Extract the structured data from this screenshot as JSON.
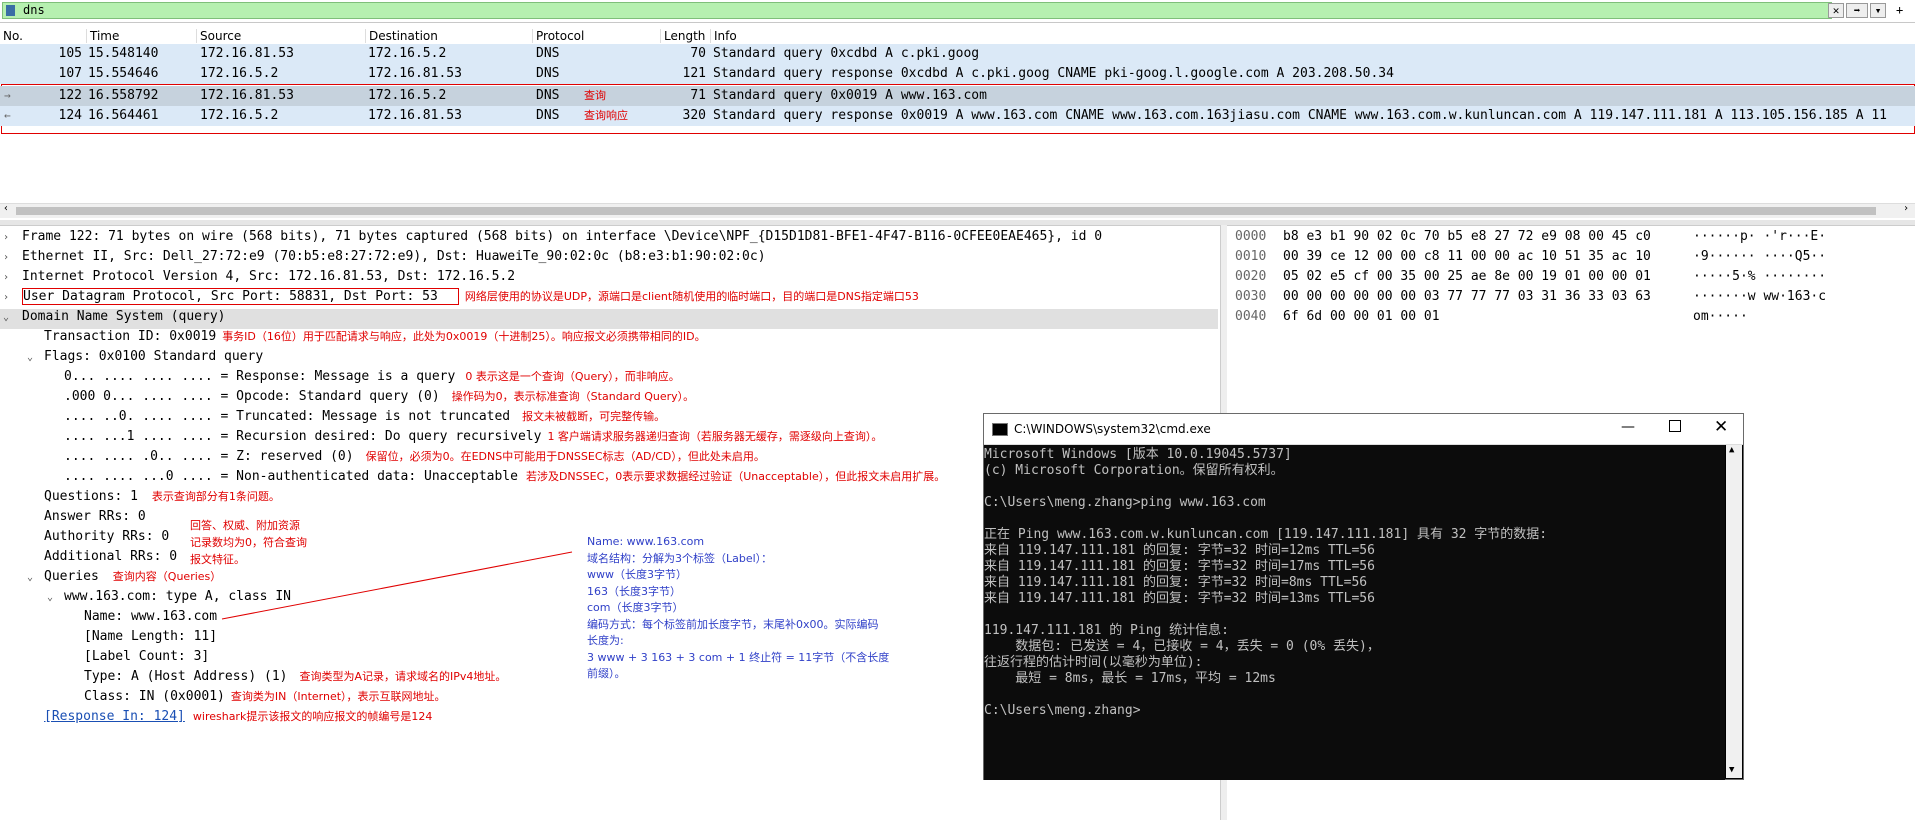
{
  "filter": {
    "value": "dns"
  },
  "packet_list": {
    "headers": [
      "No.",
      "Time",
      "Source",
      "Destination",
      "Protocol",
      "Length",
      "Info"
    ],
    "rows": [
      {
        "no": "105",
        "time": "15.548140",
        "src": "172.16.81.53",
        "dst": "172.16.5.2",
        "proto": "DNS",
        "len": "70",
        "info": "Standard query 0xcdbd A c.pki.goog",
        "note": ""
      },
      {
        "no": "107",
        "time": "15.554646",
        "src": "172.16.5.2",
        "dst": "172.16.81.53",
        "proto": "DNS",
        "len": "121",
        "info": "Standard query response 0xcdbd A c.pki.goog CNAME pki-goog.l.google.com A 203.208.50.34",
        "note": ""
      },
      {
        "no": "122",
        "time": "16.558792",
        "src": "172.16.81.53",
        "dst": "172.16.5.2",
        "proto": "DNS",
        "len": "71",
        "info": "Standard query 0x0019 A www.163.com",
        "note": "查询"
      },
      {
        "no": "124",
        "time": "16.564461",
        "src": "172.16.5.2",
        "dst": "172.16.81.53",
        "proto": "DNS",
        "len": "320",
        "info": "Standard query response 0x0019 A www.163.com CNAME www.163.com.163jiasu.com CNAME www.163.com.w.kunluncan.com A 119.147.111.181 A 113.105.156.185 A 11",
        "note": "查询响应"
      }
    ]
  },
  "details": {
    "frame": "Frame 122: 71 bytes on wire (568 bits), 71 bytes captured (568 bits) on interface \\Device\\NPF_{D15D1D81-BFE1-4F47-B116-0CFEE0EAE465}, id 0",
    "ethernet": "Ethernet II, Src: Dell_27:72:e9 (70:b5:e8:27:72:e9), Dst: HuaweiTe_90:02:0c (b8:e3:b1:90:02:0c)",
    "ip": "Internet Protocol Version 4, Src: 172.16.81.53, Dst: 172.16.5.2",
    "udp": "User Datagram Protocol, Src Port: 58831, Dst Port: 53",
    "udp_note": "网络层使用的协议是UDP，源端口是client随机使用的临时端口，目的端口是DNS指定端口53",
    "dns": "Domain Name System (query)",
    "txid": "Transaction ID: 0x0019",
    "txid_note": "事务ID（16位）用于匹配请求与响应，此处为0x0019（十进制25）。响应报文必须携带相同的ID。",
    "flags": "Flags: 0x0100 Standard query",
    "flag_lines": [
      {
        "text": "0... .... .... .... = Response: Message is a query",
        "note": "0 表示这是一个查询（Query），而非响应。"
      },
      {
        "text": ".000 0... .... .... = Opcode: Standard query (0)",
        "note": "操作码为0，表示标准查询（Standard Query）。"
      },
      {
        "text": ".... ..0. .... .... = Truncated: Message is not truncated",
        "note": "报文未被截断，可完整传输。"
      },
      {
        "text": ".... ...1 .... .... = Recursion desired: Do query recursively",
        "note": "1 客户端请求服务器递归查询（若服务器无缓存，需逐级向上查询）。"
      },
      {
        "text": ".... .... .0.. .... = Z: reserved (0)",
        "note": "保留位，必须为0。在EDNS中可能用于DNSSEC标志（AD/CD），但此处未启用。"
      },
      {
        "text": ".... .... ...0 .... = Non-authenticated data: Unacceptable",
        "note": "若涉及DNSSEC，0表示要求数据经过验证（Unacceptable），但此报文未启用扩展。"
      }
    ],
    "questions": "Questions: 1",
    "questions_note": "表示查询部分有1条问题。",
    "answer_rrs": "Answer RRs: 0",
    "authority_rrs": "Authority RRs: 0",
    "additional_rrs": "Additional RRs: 0",
    "rr_note": [
      "回答、权威、附加资源",
      "记录数均为0，符合查询",
      "报文特征。"
    ],
    "queries": "Queries",
    "queries_note": "查询内容（Queries）",
    "query_item": "www.163.com: type A, class IN",
    "name": "Name: www.163.com",
    "name_len": "[Name Length: 11]",
    "label_count": "[Label Count: 3]",
    "type": "Type: A (Host Address) (1)",
    "type_note": "查询类型为A记录，请求域名的IPv4地址。",
    "class": "Class: IN (0x0001)",
    "class_note": "查询类为IN（Internet），表示互联网地址。",
    "response_in": "[Response In: 124]",
    "response_note": "wireshark提示该报文的响应报文的帧编号是124",
    "name_explain": [
      "Name: www.163.com",
      "域名结构：分解为3个标签（Label）：",
      "www（长度3字节）",
      "163（长度3字节）",
      "com（长度3字节）",
      "编码方式：每个标签前加长度字节，末尾补0x00。实际编码",
      "长度为:",
      "3 www + 3 163 + 3 com + 1 终止符 = 11字节（不含长度",
      "前缀）。"
    ]
  },
  "hex": [
    {
      "off": "0000",
      "bytes": "b8 e3 b1 90 02 0c 70 b5  e8 27 72 e9 08 00 45 c0",
      "ascii": "······p· ·'r···E·"
    },
    {
      "off": "0010",
      "bytes": "00 39 ce 12 00 00 c8 11  00 00 ac 10 51 35 ac 10",
      "ascii": "·9······ ····Q5··"
    },
    {
      "off": "0020",
      "bytes": "05 02 e5 cf 00 35 00 25  ae 8e 00 19 01 00 00 01",
      "ascii": "·····5·% ········"
    },
    {
      "off": "0030",
      "bytes": "00 00 00 00 00 00 03 77  77 77 03 31 36 33 03 63",
      "ascii": "·······w ww·163·c"
    },
    {
      "off": "0040",
      "bytes": "6f 6d 00 00 01 00 01",
      "ascii": "om·····"
    }
  ],
  "cmd": {
    "title": "C:\\WINDOWS\\system32\\cmd.exe",
    "lines": [
      "Microsoft Windows [版本 10.0.19045.5737]",
      "(c) Microsoft Corporation。保留所有权利。",
      "",
      "C:\\Users\\meng.zhang>ping www.163.com",
      "",
      "正在 Ping www.163.com.w.kunluncan.com [119.147.111.181] 具有 32 字节的数据:",
      "来自 119.147.111.181 的回复: 字节=32 时间=12ms TTL=56",
      "来自 119.147.111.181 的回复: 字节=32 时间=17ms TTL=56",
      "来自 119.147.111.181 的回复: 字节=32 时间=8ms TTL=56",
      "来自 119.147.111.181 的回复: 字节=32 时间=13ms TTL=56",
      "",
      "119.147.111.181 的 Ping 统计信息:",
      "    数据包: 已发送 = 4，已接收 = 4，丢失 = 0 (0% 丢失)，",
      "往返行程的估计时间(以毫秒为单位):",
      "    最短 = 8ms，最长 = 17ms，平均 = 12ms",
      "",
      "C:\\Users\\meng.zhang>"
    ]
  }
}
